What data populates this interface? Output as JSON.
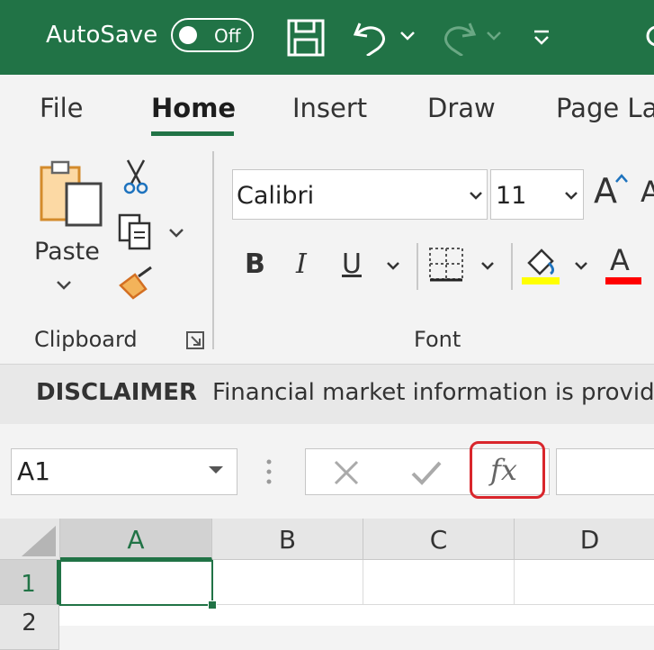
{
  "titlebar": {
    "autosave_label": "AutoSave",
    "autosave_state": "Off",
    "icons": [
      "save-icon",
      "undo-icon",
      "redo-icon",
      "customize-qat-icon"
    ]
  },
  "tabs": [
    {
      "label": "File"
    },
    {
      "label": "Home",
      "active": true
    },
    {
      "label": "Insert"
    },
    {
      "label": "Draw"
    },
    {
      "label": "Page La"
    }
  ],
  "ribbon": {
    "clipboard": {
      "paste_label": "Paste",
      "group_label": "Clipboard"
    },
    "font": {
      "font_name": "Calibri",
      "font_size": "11",
      "group_label": "Font",
      "bold": "B",
      "italic": "I",
      "underline": "U",
      "font_color_glyph": "A",
      "grow_glyph": "A",
      "shrink_glyph": "A"
    }
  },
  "disclaimer": {
    "title": "DISCLAIMER",
    "text": "Financial market information is provid"
  },
  "formula_bar": {
    "name_box": "A1",
    "fx_label": "fx"
  },
  "grid": {
    "columns": [
      "A",
      "B",
      "C",
      "D"
    ],
    "rows": [
      "1",
      "2"
    ]
  },
  "colors": {
    "accent": "#217346",
    "highlight": "#d9262c",
    "fill_yellow": "#ffff00",
    "font_red": "#ff0000"
  }
}
